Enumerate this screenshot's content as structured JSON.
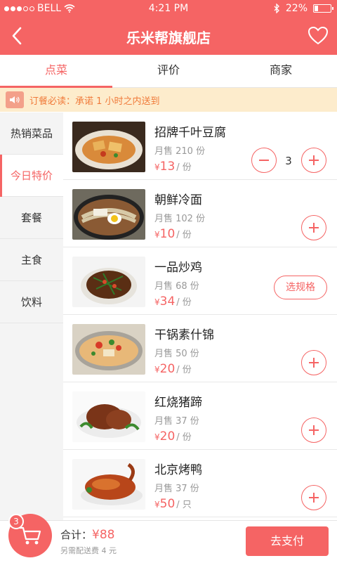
{
  "status_bar": {
    "carrier": "BELL",
    "time": "4:21 PM",
    "battery": "22%",
    "battery_level": 0.22
  },
  "nav": {
    "title": "乐米帮旗舰店"
  },
  "tabs": [
    {
      "label": "点菜"
    },
    {
      "label": "评价"
    },
    {
      "label": "商家"
    }
  ],
  "notice": {
    "text": "订餐必读：承诺 1 小时之内送到"
  },
  "sidebar": {
    "items": [
      {
        "label": "热销菜品"
      },
      {
        "label": "今日特价"
      },
      {
        "label": "套餐"
      },
      {
        "label": "主食"
      },
      {
        "label": "饮料"
      }
    ]
  },
  "dishes": [
    {
      "name": "招牌千叶豆腐",
      "sold": "月售 210 份",
      "currency": "¥",
      "price": "13",
      "unit": "/ 份",
      "qty": "3"
    },
    {
      "name": "朝鲜冷面",
      "sold": "月售 102 份",
      "currency": "¥",
      "price": "10",
      "unit": "/ 份"
    },
    {
      "name": "一品炒鸡",
      "sold": "月售 68 份",
      "currency": "¥",
      "price": "34",
      "unit": "/ 份",
      "spec_label": "选规格"
    },
    {
      "name": "干锅素什锦",
      "sold": "月售 50 份",
      "currency": "¥",
      "price": "20",
      "unit": "/ 份"
    },
    {
      "name": "红烧猪蹄",
      "sold": "月售 37 份",
      "currency": "¥",
      "price": "20",
      "unit": "/ 份"
    },
    {
      "name": "北京烤鸭",
      "sold": "月售 37 份",
      "currency": "¥",
      "price": "50",
      "unit": "/ 只"
    }
  ],
  "cart": {
    "badge": "3",
    "total_label": "合计：",
    "currency": "¥",
    "total_amount": "88",
    "fee_note": "另需配送费 4 元",
    "pay_label": "去支付"
  },
  "icons": {
    "back": "back-arrow-icon",
    "favorite": "heart-icon",
    "speaker": "speaker-icon",
    "cart": "cart-icon",
    "plus": "plus-icon",
    "minus": "minus-icon"
  },
  "colors": {
    "brand": "#f56464",
    "notice_bg": "#fdeccc",
    "notice_text": "#f07a3a"
  }
}
